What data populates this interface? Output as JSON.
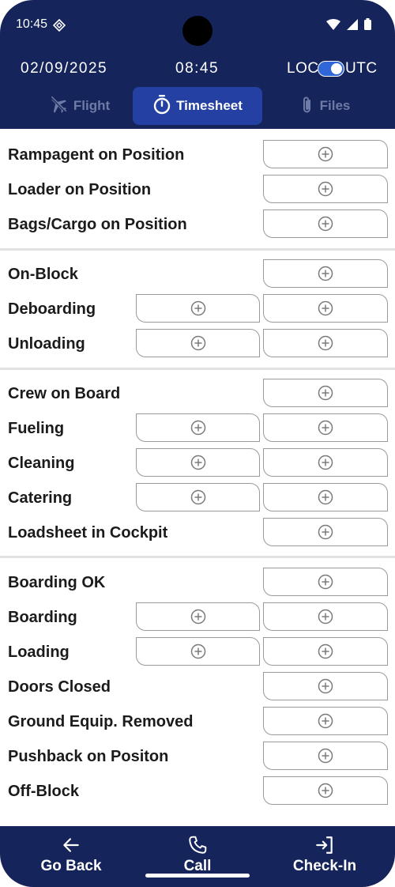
{
  "status_bar": {
    "time": "10:45"
  },
  "header": {
    "date": "02/09/2025",
    "clock": "08:45",
    "loc_label": "LOC",
    "utc_label": "UTC",
    "utc_enabled": true
  },
  "tabs": [
    {
      "label": "Flight",
      "icon": "airplane-icon",
      "active": false
    },
    {
      "label": "Timesheet",
      "icon": "stopwatch-icon",
      "active": true
    },
    {
      "label": "Files",
      "icon": "paperclip-icon",
      "active": false
    }
  ],
  "rows": [
    {
      "label": "Rampagent on Position",
      "fields": 1
    },
    {
      "label": "Loader on Position",
      "fields": 1
    },
    {
      "label": "Bags/Cargo on Position",
      "fields": 1
    },
    {
      "label": "On-Block",
      "fields": 1
    },
    {
      "label": "Deboarding",
      "fields": 2
    },
    {
      "label": "Unloading",
      "fields": 2
    },
    {
      "label": "Crew on Board",
      "fields": 1
    },
    {
      "label": "Fueling",
      "fields": 2
    },
    {
      "label": "Cleaning",
      "fields": 2
    },
    {
      "label": "Catering",
      "fields": 2
    },
    {
      "label": "Loadsheet in Cockpit",
      "fields": 1
    },
    {
      "label": "Boarding OK",
      "fields": 1
    },
    {
      "label": "Boarding",
      "fields": 2
    },
    {
      "label": "Loading",
      "fields": 2
    },
    {
      "label": "Doors Closed",
      "fields": 1
    },
    {
      "label": "Ground Equip. Removed",
      "fields": 1
    },
    {
      "label": "Pushback on Positon",
      "fields": 1
    },
    {
      "label": "Off-Block",
      "fields": 1
    }
  ],
  "bottom_nav": {
    "go_back": "Go Back",
    "call": "Call",
    "check_in": "Check-In"
  },
  "colors": {
    "header_bg": "#15245a",
    "active_tab": "#2440a2",
    "inactive_tab_text": "#6d7ba6",
    "toggle_on": "#2f66d8"
  }
}
